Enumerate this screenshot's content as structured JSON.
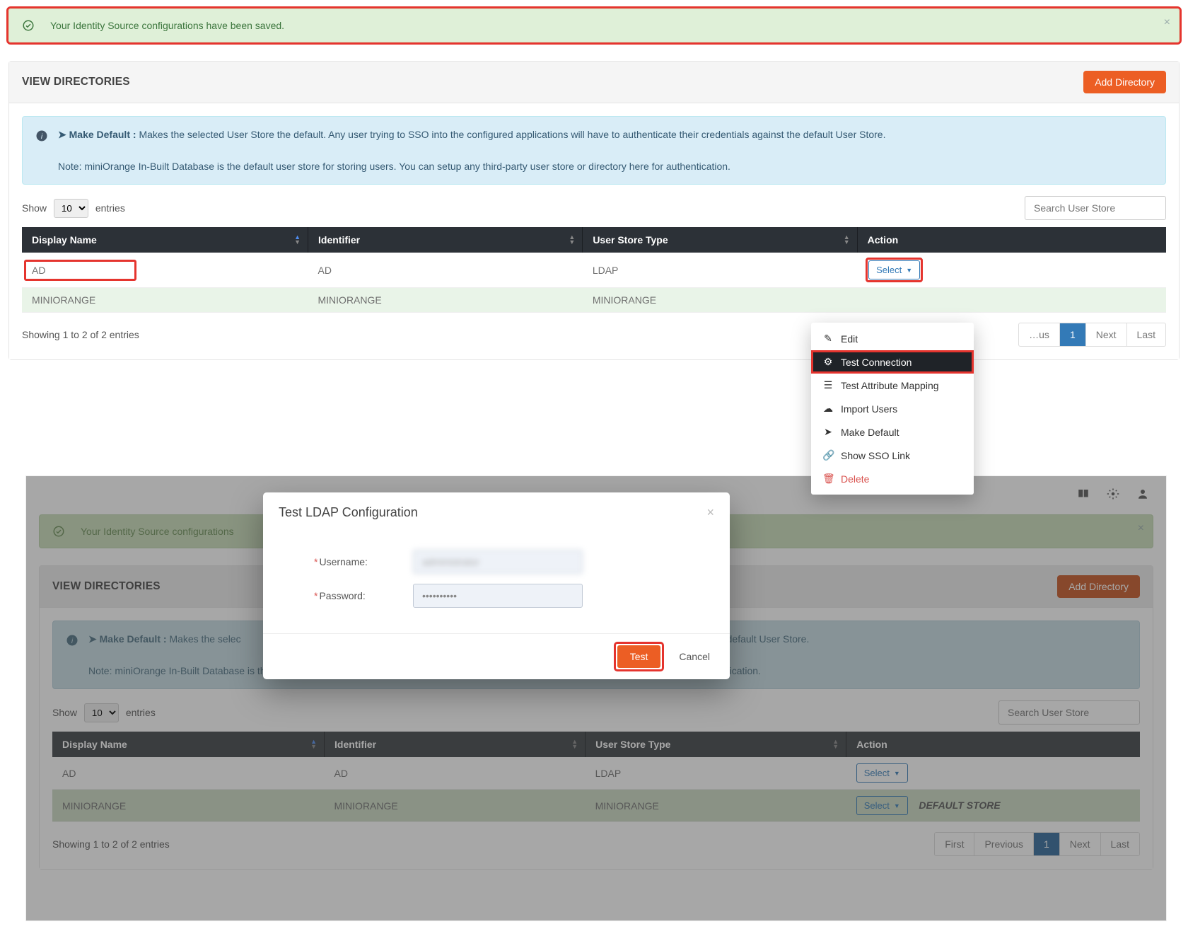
{
  "alert": {
    "text": "Your Identity Source configurations have been saved."
  },
  "card": {
    "title": "VIEW DIRECTORIES",
    "add_button": "Add Directory"
  },
  "info": {
    "lead_label": "Make Default :",
    "lead_text": " Makes the selected User Store the default. Any user trying to SSO into the configured applications will have to authenticate their credentials against the default User Store.",
    "note": "Note: miniOrange In-Built Database is the default user store for storing users. You can setup any third-party user store or directory here for authentication."
  },
  "table_controls": {
    "show_label_pre": "Show",
    "show_label_post": "entries",
    "page_size": "10",
    "search_placeholder": "Search User Store"
  },
  "columns": {
    "display_name": "Display Name",
    "identifier": "Identifier",
    "user_store_type": "User Store Type",
    "action": "Action"
  },
  "rows": [
    {
      "display_name": "AD",
      "identifier": "AD",
      "user_store_type": "LDAP",
      "select": "Select"
    },
    {
      "display_name": "MINIORANGE",
      "identifier": "MINIORANGE",
      "user_store_type": "MINIORANGE",
      "select": "Select",
      "default_store": "DEFAULT STORE"
    }
  ],
  "table_footer": {
    "info": "Showing 1 to 2 of 2 entries",
    "first": "First",
    "prev": "Previous",
    "page": "1",
    "next": "Next",
    "last": "Last"
  },
  "dropdown": {
    "edit": "Edit",
    "test_conn": "Test Connection",
    "test_attr": "Test Attribute Mapping",
    "import": "Import Users",
    "make_default": "Make Default",
    "show_sso": "Show SSO Link",
    "delete": "Delete"
  },
  "modal": {
    "title": "Test LDAP Configuration",
    "username_label": "Username:",
    "password_label": "Password:",
    "username_value": "administrator",
    "password_value": "••••••••••",
    "test": "Test",
    "cancel": "Cancel"
  }
}
